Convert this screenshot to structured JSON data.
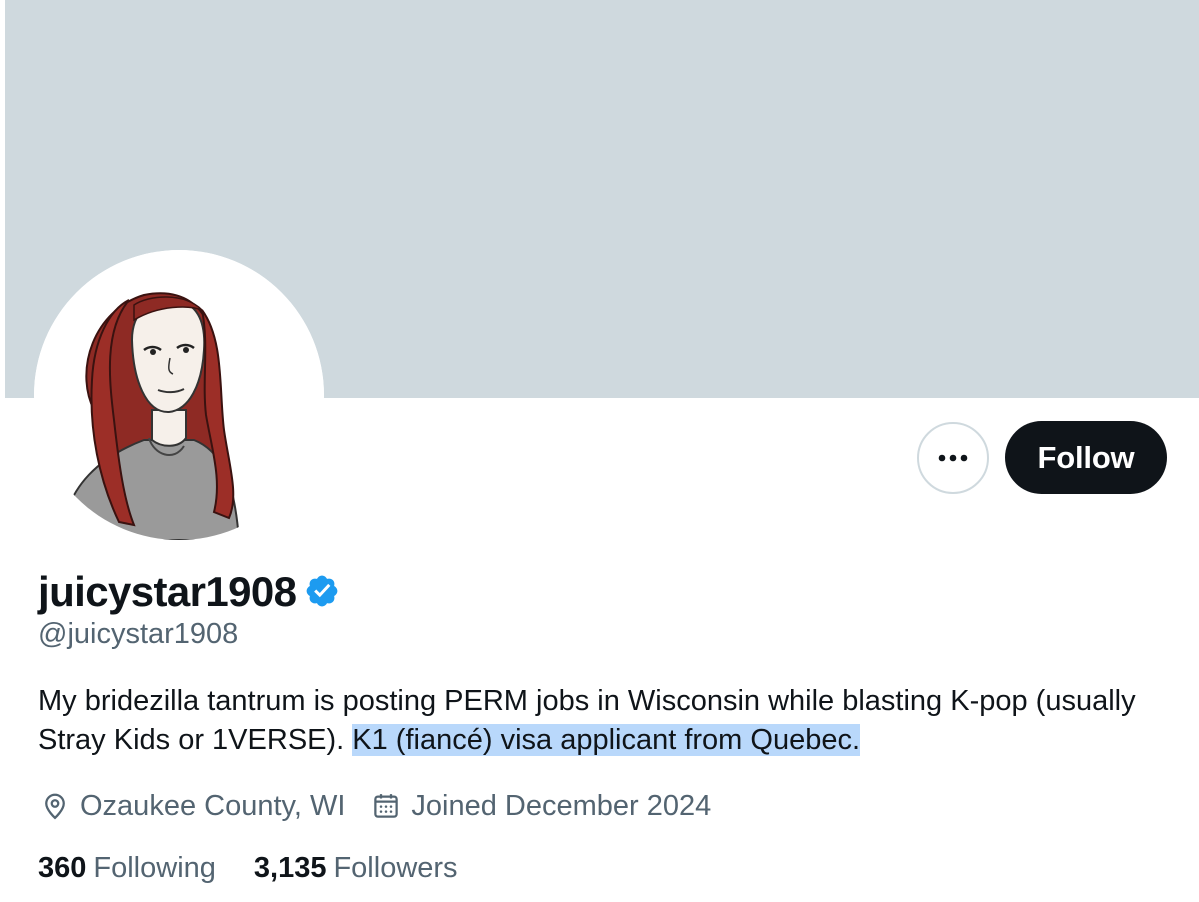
{
  "profile": {
    "display_name": "juicystar1908",
    "handle": "@juicystar1908",
    "verified_icon": "verified-badge-icon",
    "bio_main": "My bridezilla tantrum is posting PERM jobs in Wisconsin while blasting K-pop (usually Stray Kids or 1VERSE). ",
    "bio_highlighted": "K1 (fiancé) visa applicant from Quebec.",
    "location": "Ozaukee County, WI",
    "joined": "Joined December 2024",
    "following_count": "360",
    "following_label": "Following",
    "followers_count": "3,135",
    "followers_label": "Followers"
  },
  "actions": {
    "more_label": "•••",
    "follow_label": "Follow"
  },
  "colors": {
    "banner": "#cfd9de",
    "text_primary": "#0f1419",
    "text_secondary": "#536471",
    "verified_blue": "#1d9bf0",
    "selection_highlight": "#b9d8fb"
  }
}
